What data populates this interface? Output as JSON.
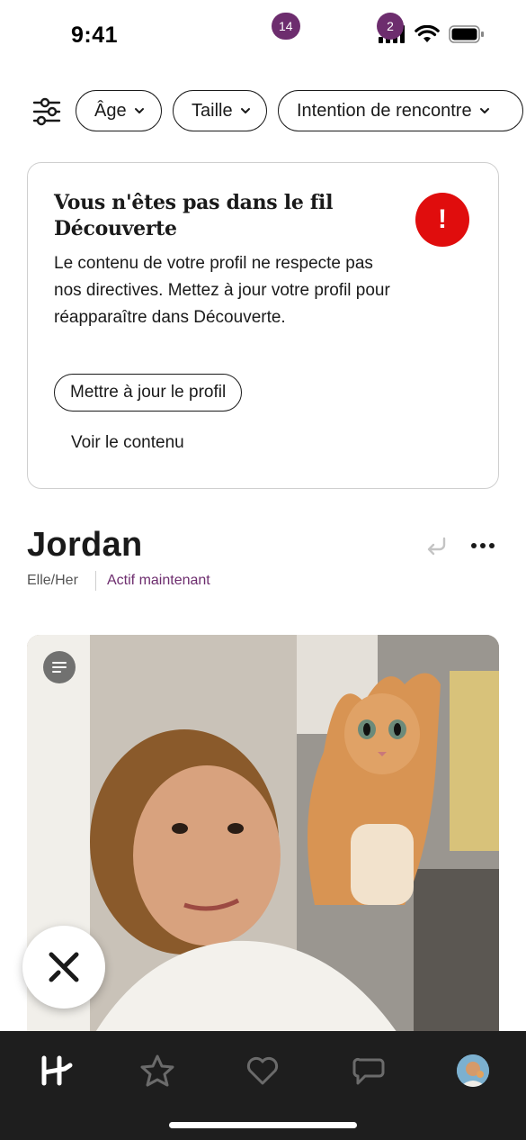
{
  "status_bar": {
    "time": "9:41"
  },
  "filters": {
    "settings_icon": "sliders-icon",
    "chips": [
      {
        "label": "Âge"
      },
      {
        "label": "Taille"
      },
      {
        "label": "Intention de rencontre"
      }
    ]
  },
  "alert": {
    "title": "Vous n'êtes pas dans le fil Découverte",
    "body": "Le contenu de votre profil ne respecte pas nos directives. Mettez à jour votre profil pour réapparaître dans Découverte.",
    "badge_symbol": "!",
    "badge_color": "#e00d0d",
    "primary_button": "Mettre à jour le profil",
    "secondary_button": "Voir le contenu"
  },
  "profile": {
    "name": "Jordan",
    "pronouns": "Elle/Her",
    "activity": "Actif maintenant",
    "activity_color": "#6d2d6e"
  },
  "bottom_nav": {
    "items": [
      {
        "icon": "home-logo-icon"
      },
      {
        "icon": "star-icon"
      },
      {
        "icon": "heart-icon",
        "badge": "14"
      },
      {
        "icon": "chat-icon",
        "badge": "2"
      },
      {
        "icon": "avatar"
      }
    ],
    "badge_color": "#6d2d6e"
  }
}
